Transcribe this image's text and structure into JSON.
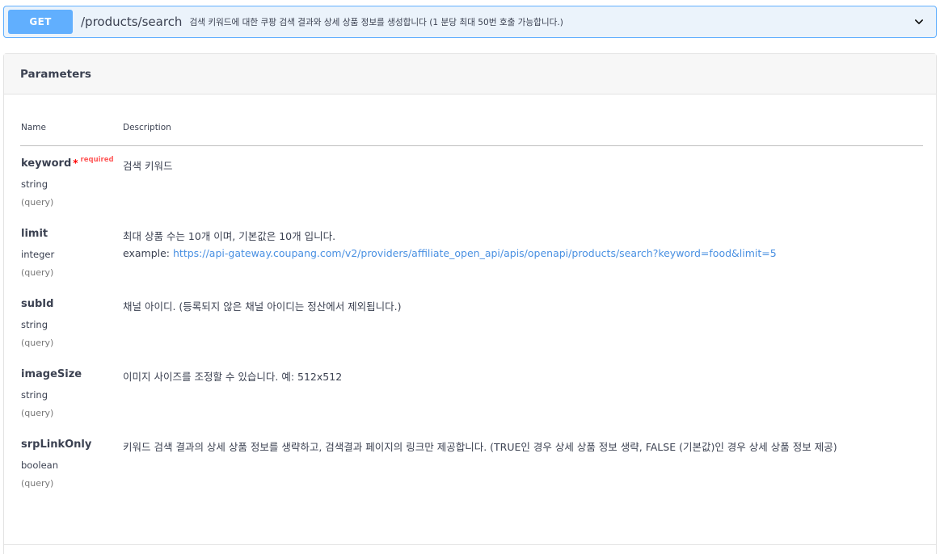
{
  "operation": {
    "method": "GET",
    "path": "/products/search",
    "summary": "검색 키워드에 대한 쿠팡 검색 결과와 상세 상품 정보를 생성합니다 (1 분당 최대 50번 호출 가능합니다.)",
    "chevron_icon": "chevron-down-icon"
  },
  "parameters": {
    "title": "Parameters",
    "columns": {
      "name": "Name",
      "description": "Description"
    },
    "required_star": "*",
    "required_label": "required",
    "example_prefix": "example: ",
    "items": [
      {
        "name": "keyword",
        "type": "string",
        "in": "(query)",
        "description": "검색 키워드"
      },
      {
        "name": "limit",
        "type": "integer",
        "in": "(query)",
        "description": "최대 상품 수는 10개 이며, 기본값은 10개 입니다.",
        "example": "https://api-gateway.coupang.com/v2/providers/affiliate_open_api/apis/openapi/products/search?keyword=food&limit=5"
      },
      {
        "name": "subId",
        "type": "string",
        "in": "(query)",
        "description": "채널 아이디. (등록되지 않은 채널 아이디는 정산에서 제외됩니다.)"
      },
      {
        "name": "imageSize",
        "type": "string",
        "in": "(query)",
        "description": "이미지 사이즈를 조정할 수 있습니다. 예: 512x512"
      },
      {
        "name": "srpLinkOnly",
        "type": "boolean",
        "in": "(query)",
        "description": "키워드 검색 결과의 상세 상품 정보를 생략하고, 검색결과 페이지의 링크만 제공합니다. (TRUE인 경우 상세 상품 정보 생략, FALSE (기본값)인 경우 상세 상품 정보 제공)"
      }
    ]
  },
  "colors": {
    "get_accent": "#61affe",
    "summary_bg": "#ebf3fb",
    "required": "#ff0000",
    "link": "#4990e2"
  }
}
